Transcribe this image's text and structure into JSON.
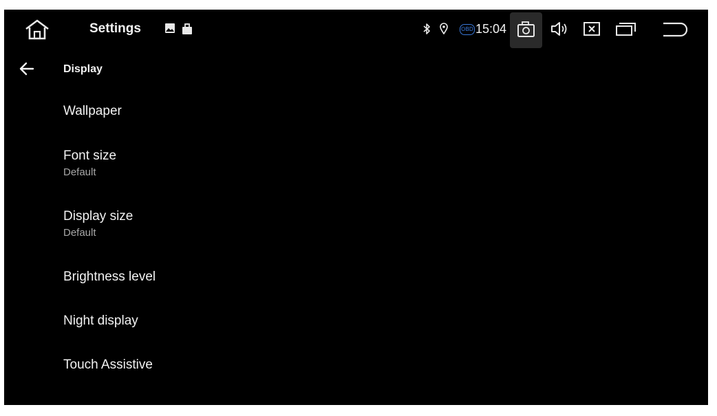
{
  "statusbar": {
    "app_title": "Settings",
    "clock": "15:04",
    "obd_badge": "OBD",
    "icons": {
      "home": "home-icon",
      "notif_image": "image-notification-icon",
      "notif_bag": "bag-notification-icon",
      "bluetooth": "bluetooth-icon",
      "location": "location-pin-icon",
      "camera": "screenshot-camera-icon",
      "volume": "volume-icon",
      "close": "close-app-icon",
      "recents": "recent-apps-icon",
      "back": "back-return-icon"
    }
  },
  "page": {
    "back_icon": "arrow-left-icon",
    "title": "Display"
  },
  "items": [
    {
      "title": "Wallpaper",
      "subtitle": ""
    },
    {
      "title": "Font size",
      "subtitle": "Default"
    },
    {
      "title": "Display size",
      "subtitle": "Default"
    },
    {
      "title": "Brightness level",
      "subtitle": ""
    },
    {
      "title": "Night display",
      "subtitle": ""
    },
    {
      "title": "Touch Assistive",
      "subtitle": ""
    }
  ],
  "colors": {
    "background": "#000000",
    "text": "#f2f2f2",
    "subtext": "#a8a8a8",
    "accent": "#3a78d8"
  }
}
